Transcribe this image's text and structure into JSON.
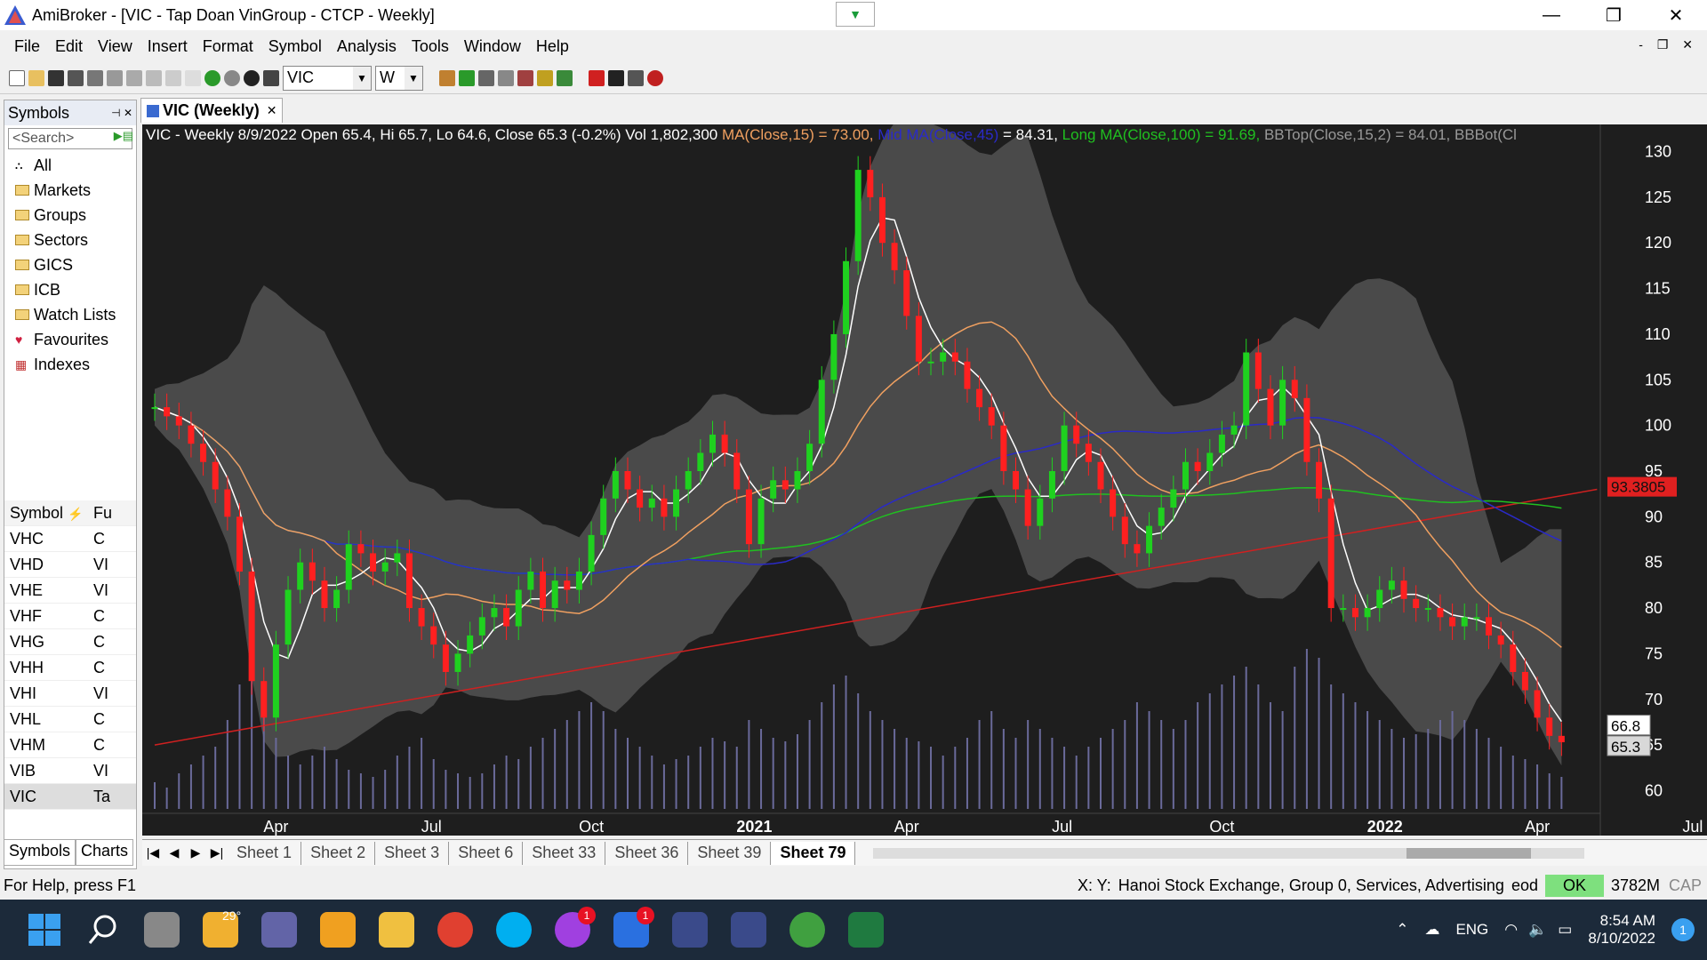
{
  "window": {
    "app": "AmiBroker",
    "title": "AmiBroker - [VIC - Tap Doan VinGroup - CTCP - Weekly]"
  },
  "menu": [
    "File",
    "Edit",
    "View",
    "Insert",
    "Format",
    "Symbol",
    "Analysis",
    "Tools",
    "Window",
    "Help"
  ],
  "toolbar": {
    "symbol": "VIC",
    "interval": "W"
  },
  "sidebar": {
    "title": "Symbols",
    "search_placeholder": "<Search>",
    "tree": [
      "All",
      "Markets",
      "Groups",
      "Sectors",
      "GICS",
      "ICB",
      "Watch Lists",
      "Favourites",
      "Indexes"
    ],
    "table_headers": [
      "Symbol",
      "Fu"
    ],
    "rows": [
      [
        "VHC",
        "C"
      ],
      [
        "VHD",
        "VI"
      ],
      [
        "VHE",
        "VI"
      ],
      [
        "VHF",
        "C"
      ],
      [
        "VHG",
        "C"
      ],
      [
        "VHH",
        "C"
      ],
      [
        "VHI",
        "VI"
      ],
      [
        "VHL",
        "C"
      ],
      [
        "VHM",
        "C"
      ],
      [
        "VIB",
        "VI"
      ],
      [
        "VIC",
        "Ta"
      ]
    ],
    "tabs": [
      "Symbols",
      "Charts"
    ]
  },
  "document_tab": "VIC (Weekly)",
  "legend": {
    "main": "VIC - Weekly 8/9/2022 Open 65.4, Hi 65.7, Lo 64.6, Close 65.3 (-0.2%) Vol 1,802,300 ",
    "ma15": "MA(Close,15) = 73.00,",
    "mid": " Mid MA(Close,45)",
    "mid_val": " = 84.31, ",
    "long": "Long MA(Close,100) = 91.69, ",
    "bbtop": "BBTop(Close,15,2) = 84.01, ",
    "bbbot": "BBBot(Cl"
  },
  "colors": {
    "up": "#1fd11f",
    "down": "#ff2020",
    "ma15": "#f0a060",
    "mid": "#2a2ac8",
    "long": "#20c020",
    "trend": "#d02020",
    "band": "#5a5a5a"
  },
  "chart_data": {
    "type": "candlestick",
    "ylim": [
      58,
      132
    ],
    "yticks": [
      60,
      65,
      70,
      75,
      80,
      85,
      90,
      95,
      100,
      105,
      110,
      115,
      120,
      125,
      130
    ],
    "xticks": [
      {
        "label": "Apr",
        "i": 10
      },
      {
        "label": "Jul",
        "i": 23
      },
      {
        "label": "Oct",
        "i": 36
      },
      {
        "label": "2021",
        "i": 49
      },
      {
        "label": "Apr",
        "i": 62
      },
      {
        "label": "Jul",
        "i": 75
      },
      {
        "label": "Oct",
        "i": 88
      },
      {
        "label": "2022",
        "i": 101
      },
      {
        "label": "Apr",
        "i": 114
      },
      {
        "label": "Jul",
        "i": 127
      }
    ],
    "closes": [
      102,
      101,
      100,
      98,
      96,
      93,
      90,
      84,
      72,
      68,
      76,
      82,
      85,
      83,
      80,
      82,
      87,
      86,
      84,
      85,
      86,
      80,
      78,
      76,
      73,
      75,
      77,
      79,
      80,
      78,
      82,
      84,
      80,
      83,
      82,
      84,
      88,
      92,
      95,
      93,
      91,
      92,
      90,
      93,
      95,
      97,
      99,
      97,
      93,
      87,
      92,
      94,
      93,
      95,
      98,
      105,
      110,
      118,
      128,
      125,
      120,
      117,
      112,
      107,
      107,
      108,
      107,
      104,
      102,
      100,
      95,
      93,
      89,
      92,
      95,
      100,
      98,
      96,
      93,
      90,
      87,
      86,
      89,
      91,
      93,
      96,
      95,
      97,
      99,
      100,
      108,
      104,
      100,
      105,
      103,
      96,
      92,
      80,
      80,
      79,
      80,
      82,
      83,
      81,
      80,
      80,
      79,
      78,
      79,
      79,
      77,
      76,
      73,
      71,
      68,
      66,
      65.3
    ],
    "volumes": [
      0.15,
      0.12,
      0.2,
      0.25,
      0.3,
      0.35,
      0.5,
      0.7,
      0.9,
      0.6,
      0.4,
      0.3,
      0.25,
      0.3,
      0.35,
      0.28,
      0.22,
      0.2,
      0.18,
      0.22,
      0.3,
      0.35,
      0.4,
      0.28,
      0.22,
      0.2,
      0.18,
      0.2,
      0.25,
      0.3,
      0.28,
      0.35,
      0.4,
      0.45,
      0.5,
      0.55,
      0.6,
      0.55,
      0.45,
      0.4,
      0.35,
      0.3,
      0.25,
      0.28,
      0.3,
      0.35,
      0.4,
      0.38,
      0.35,
      0.5,
      0.45,
      0.4,
      0.38,
      0.42,
      0.5,
      0.6,
      0.7,
      0.75,
      0.65,
      0.55,
      0.5,
      0.45,
      0.4,
      0.38,
      0.35,
      0.3,
      0.35,
      0.4,
      0.5,
      0.55,
      0.45,
      0.4,
      0.5,
      0.45,
      0.4,
      0.35,
      0.3,
      0.35,
      0.4,
      0.45,
      0.5,
      0.6,
      0.55,
      0.5,
      0.45,
      0.5,
      0.6,
      0.65,
      0.7,
      0.75,
      0.8,
      0.7,
      0.6,
      0.55,
      0.8,
      0.9,
      0.85,
      0.7,
      0.65,
      0.6,
      0.55,
      0.5,
      0.45,
      0.4,
      0.42,
      0.45,
      0.5,
      0.55,
      0.5,
      0.45,
      0.4,
      0.35,
      0.3,
      0.28,
      0.25,
      0.2,
      0.18
    ],
    "last_labels": [
      {
        "text": "66.8",
        "y": 66.8
      },
      {
        "text": "65.3",
        "y": 65.3
      }
    ],
    "cursor_label": {
      "text": "93.3805",
      "y": 93.3805
    }
  },
  "sheets": [
    "Sheet 1",
    "Sheet 2",
    "Sheet 3",
    "Sheet 6",
    "Sheet 33",
    "Sheet 36",
    "Sheet 39",
    "Sheet 79"
  ],
  "status": {
    "help": "For Help, press F1",
    "xy": "X: Y:",
    "exchange": "Hanoi Stock Exchange, Group 0, Services, Advertising",
    "eod": "eod",
    "ok": "OK",
    "mem": "3782M",
    "cap": "CAP"
  },
  "taskbar": {
    "weather": "29°",
    "lang": "ENG",
    "time": "8:54 AM",
    "date": "8/10/2022",
    "notif": "1"
  }
}
